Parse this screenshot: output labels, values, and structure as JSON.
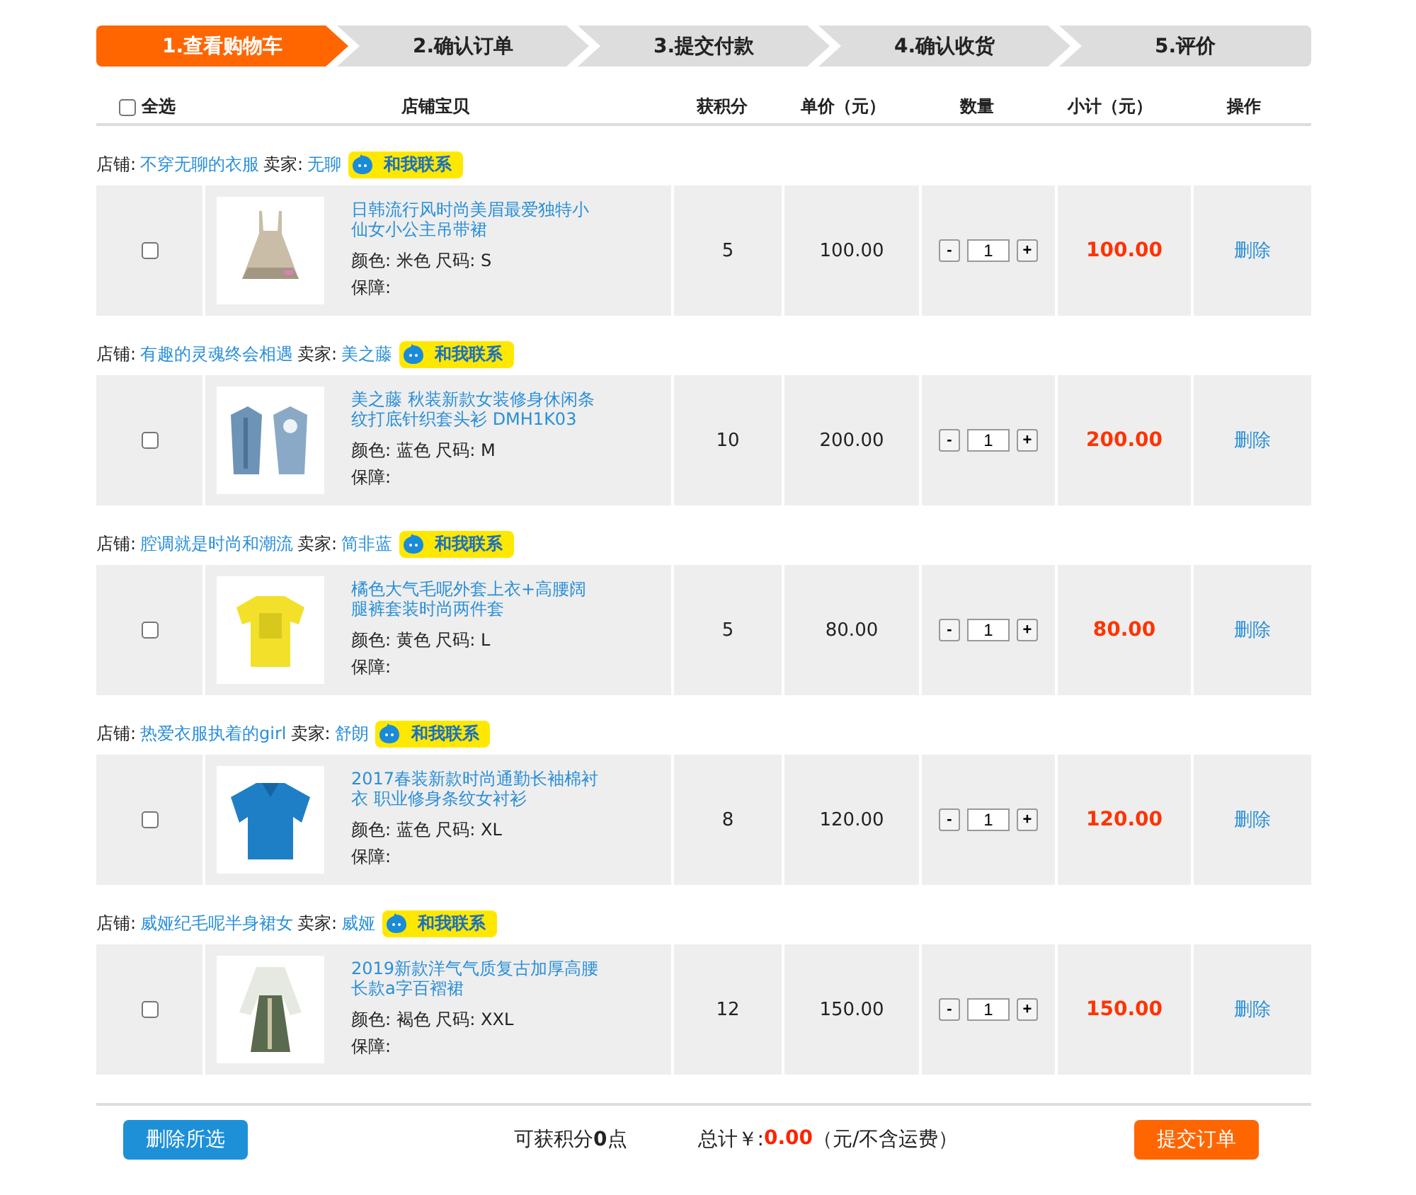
{
  "steps": [
    {
      "label": "1.查看购物车",
      "selected": true
    },
    {
      "label": "2.确认订单",
      "selected": false
    },
    {
      "label": "3.提交付款",
      "selected": false
    },
    {
      "label": "4.确认收货",
      "selected": false
    },
    {
      "label": "5.评价",
      "selected": false
    }
  ],
  "header": {
    "select_all": {
      "label": "全选",
      "checked": false
    },
    "columns": [
      "店铺宝贝",
      "获积分",
      "单价（元）",
      "数量",
      "小计（元）",
      "操作"
    ]
  },
  "groups": [
    {
      "shop_label": "店铺:",
      "shop": "不穿无聊的衣服",
      "seller_label": "卖家:",
      "seller": "无聊",
      "contact": "和我联系",
      "item": {
        "checked": false,
        "title": "日韩流行风时尚美眉最爱独特小仙女小公主吊带裙",
        "specs": "颜色: 米色 尺码: S",
        "guarantee": "保障:",
        "points": "5",
        "price": "100.00",
        "decrease": "-",
        "quantity": "1",
        "increase": "+",
        "subtotal": "100.00",
        "action": "删除"
      }
    },
    {
      "shop_label": "店铺:",
      "shop": "有趣的灵魂终会相遇",
      "seller_label": "卖家:",
      "seller": "美之藤",
      "contact": "和我联系",
      "item": {
        "checked": false,
        "title": "美之藤 秋装新款女装修身休闲条纹打底针织套头衫 DMH1K03",
        "specs": "颜色: 蓝色 尺码: M",
        "guarantee": "保障:",
        "points": "10",
        "price": "200.00",
        "decrease": "-",
        "quantity": "1",
        "increase": "+",
        "subtotal": "200.00",
        "action": "删除"
      }
    },
    {
      "shop_label": "店铺:",
      "shop": "腔调就是时尚和潮流",
      "seller_label": "卖家:",
      "seller": "简非蓝",
      "contact": "和我联系",
      "item": {
        "checked": false,
        "title": "橘色大气毛呢外套上衣+高腰阔腿裤套装时尚两件套",
        "specs": "颜色: 黄色 尺码: L",
        "guarantee": "保障:",
        "points": "5",
        "price": "80.00",
        "decrease": "-",
        "quantity": "1",
        "increase": "+",
        "subtotal": "80.00",
        "action": "删除"
      }
    },
    {
      "shop_label": "店铺:",
      "shop": "热爱衣服执着的girl",
      "seller_label": "卖家:",
      "seller": "舒朗",
      "contact": "和我联系",
      "item": {
        "checked": false,
        "title": "2017春装新款时尚通勤长袖棉衬衣 职业修身条纹女衬衫",
        "specs": "颜色: 蓝色 尺码: XL",
        "guarantee": "保障:",
        "points": "8",
        "price": "120.00",
        "decrease": "-",
        "quantity": "1",
        "increase": "+",
        "subtotal": "120.00",
        "action": "删除"
      }
    },
    {
      "shop_label": "店铺:",
      "shop": "威娅纪毛呢半身裙女",
      "seller_label": "卖家:",
      "seller": "威娅",
      "contact": "和我联系",
      "item": {
        "checked": false,
        "title": "2019新款洋气气质复古加厚高腰长款a字百褶裙",
        "specs": "颜色: 褐色 尺码: XXL",
        "guarantee": "保障:",
        "points": "12",
        "price": "150.00",
        "decrease": "-",
        "quantity": "1",
        "increase": "+",
        "subtotal": "150.00",
        "action": "删除"
      }
    }
  ],
  "footer": {
    "delete_selected": "删除所选",
    "points": "可获积分**0**点",
    "total_label": "总计￥:",
    "total": "0.00",
    "total_note": "（元/不含运费）",
    "submit": "提交订单"
  }
}
